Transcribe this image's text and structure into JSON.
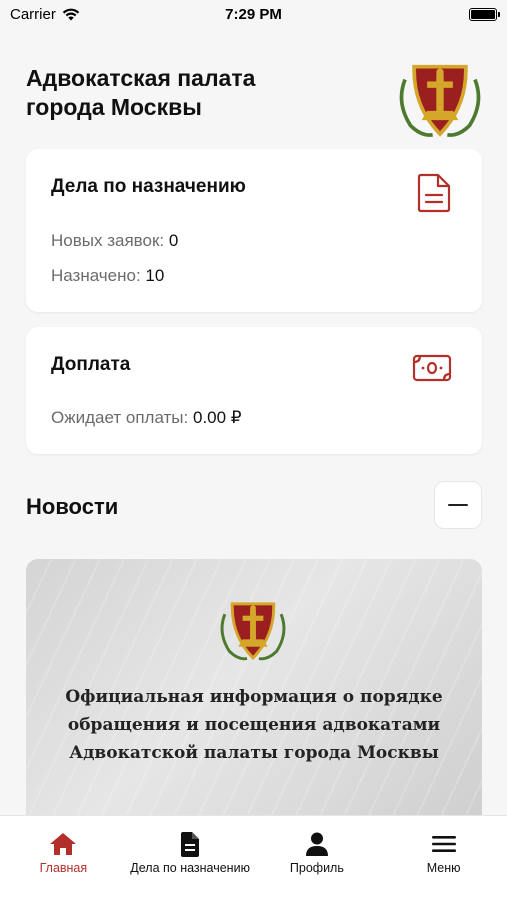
{
  "status_bar": {
    "carrier": "Carrier",
    "time": "7:29 PM",
    "battery_level": 1.0
  },
  "header": {
    "title": "Адвокатская палата\nгорода Москвы"
  },
  "cards": {
    "assignments": {
      "title": "Дела по назначению",
      "new_requests_label": "Новых заявок:",
      "new_requests_value": "0",
      "assigned_label": "Назначено:",
      "assigned_value": "10",
      "icon": "document-icon"
    },
    "payment": {
      "title": "Доплата",
      "awaiting_label": "Ожидает оплаты:",
      "awaiting_value": "0.00 ₽",
      "icon": "banknote-icon"
    }
  },
  "news": {
    "title": "Новости",
    "collapse_icon": "minus-icon",
    "items": [
      {
        "text": "Официальная информация о порядке\nобращения и посещения адвокатами\nАдвокатской палаты города Москвы"
      }
    ]
  },
  "tab_bar": {
    "tabs": [
      {
        "label": "Главная",
        "icon": "home-icon",
        "active": true
      },
      {
        "label": "Дела по назначению",
        "icon": "document-icon",
        "active": false
      },
      {
        "label": "Профиль",
        "icon": "person-icon",
        "active": false
      },
      {
        "label": "Меню",
        "icon": "hamburger-icon",
        "active": false
      }
    ]
  },
  "colors": {
    "accent": "#b3302a",
    "background": "#f6f6f6",
    "card": "#ffffff",
    "emblem_red": "#9c1f1f",
    "emblem_gold": "#d4a62a"
  }
}
